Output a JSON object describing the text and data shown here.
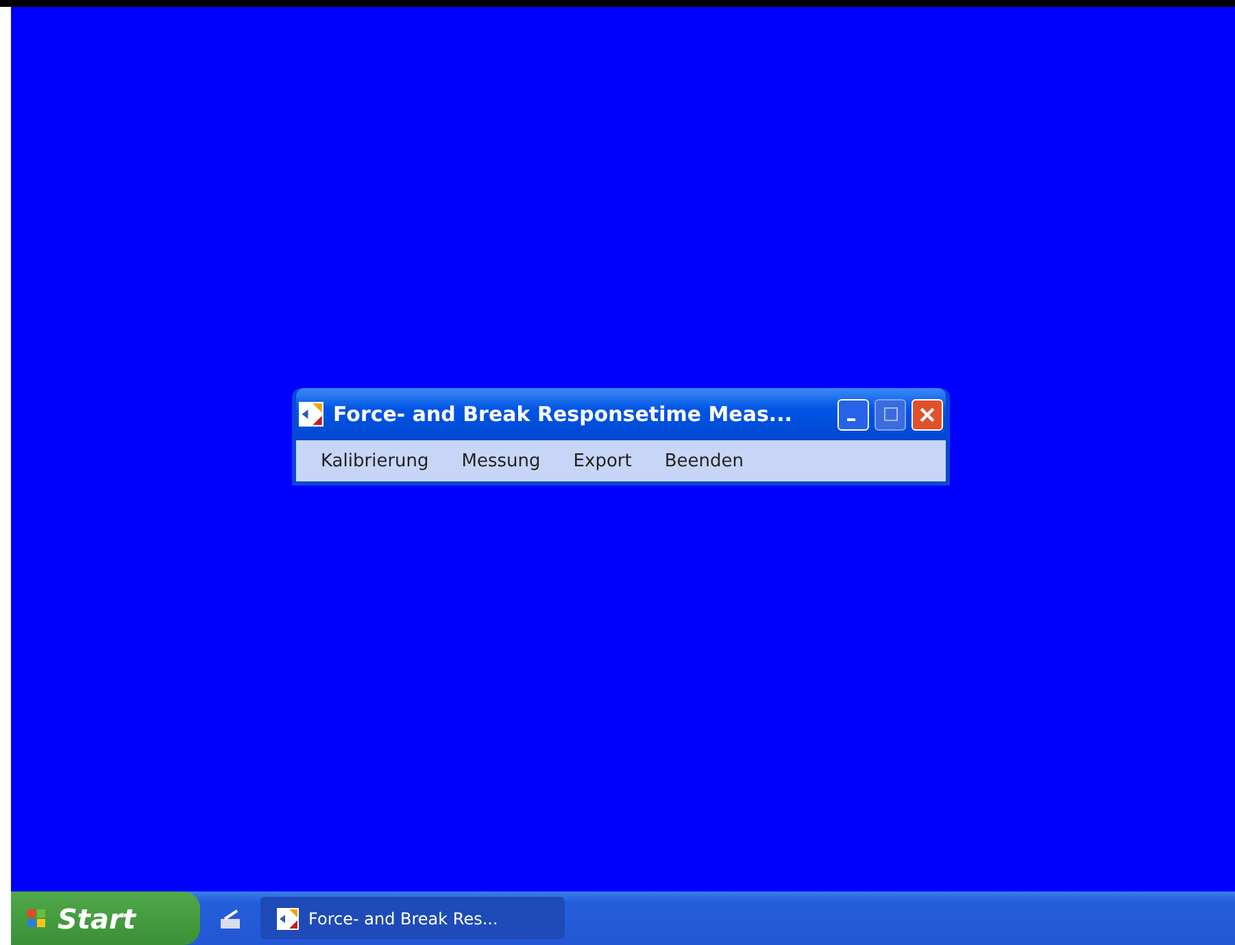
{
  "window": {
    "title": "Force- and Break Responsetime Meas...",
    "menu": [
      {
        "label": "Kalibrierung"
      },
      {
        "label": "Messung"
      },
      {
        "label": "Export"
      },
      {
        "label": "Beenden"
      }
    ]
  },
  "taskbar": {
    "start": "Start",
    "tasks": [
      {
        "label": "Force- and Break Res...",
        "selected": true
      }
    ]
  }
}
